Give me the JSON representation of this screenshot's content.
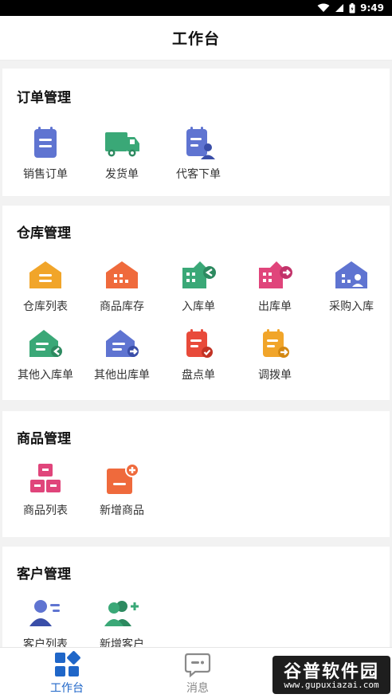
{
  "status_bar": {
    "time": "9:49"
  },
  "header": {
    "title": "工作台"
  },
  "sections": {
    "order": {
      "title": "订单管理",
      "items": [
        "销售订单",
        "发货单",
        "代客下单"
      ]
    },
    "warehouse": {
      "title": "仓库管理",
      "items": [
        "仓库列表",
        "商品库存",
        "入库单",
        "出库单",
        "采购入库",
        "其他入库单",
        "其他出库单",
        "盘点单",
        "调拨单"
      ]
    },
    "goods": {
      "title": "商品管理",
      "items": [
        "商品列表",
        "新增商品"
      ]
    },
    "customer": {
      "title": "客户管理",
      "items": [
        "客户列表",
        "新增客户"
      ]
    }
  },
  "tabbar": {
    "tabs": [
      "工作台",
      "消息"
    ],
    "active_color": "#1f66c8",
    "inactive_color": "#888888"
  },
  "watermark": {
    "title": "谷普软件园",
    "url": "www.gupuxiazai.com"
  }
}
